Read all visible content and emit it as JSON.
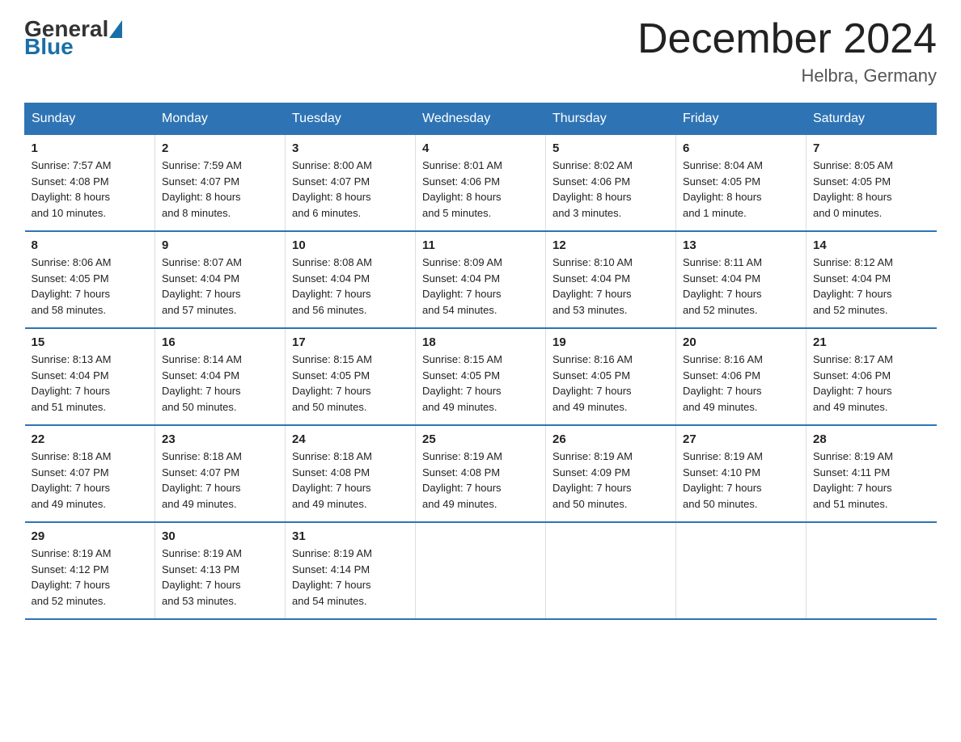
{
  "header": {
    "logo_general": "General",
    "logo_blue": "Blue",
    "main_title": "December 2024",
    "subtitle": "Helbra, Germany"
  },
  "days_of_week": [
    "Sunday",
    "Monday",
    "Tuesday",
    "Wednesday",
    "Thursday",
    "Friday",
    "Saturday"
  ],
  "weeks": [
    [
      {
        "day": "1",
        "sunrise": "7:57 AM",
        "sunset": "4:08 PM",
        "daylight": "8 hours and 10 minutes."
      },
      {
        "day": "2",
        "sunrise": "7:59 AM",
        "sunset": "4:07 PM",
        "daylight": "8 hours and 8 minutes."
      },
      {
        "day": "3",
        "sunrise": "8:00 AM",
        "sunset": "4:07 PM",
        "daylight": "8 hours and 6 minutes."
      },
      {
        "day": "4",
        "sunrise": "8:01 AM",
        "sunset": "4:06 PM",
        "daylight": "8 hours and 5 minutes."
      },
      {
        "day": "5",
        "sunrise": "8:02 AM",
        "sunset": "4:06 PM",
        "daylight": "8 hours and 3 minutes."
      },
      {
        "day": "6",
        "sunrise": "8:04 AM",
        "sunset": "4:05 PM",
        "daylight": "8 hours and 1 minute."
      },
      {
        "day": "7",
        "sunrise": "8:05 AM",
        "sunset": "4:05 PM",
        "daylight": "8 hours and 0 minutes."
      }
    ],
    [
      {
        "day": "8",
        "sunrise": "8:06 AM",
        "sunset": "4:05 PM",
        "daylight": "7 hours and 58 minutes."
      },
      {
        "day": "9",
        "sunrise": "8:07 AM",
        "sunset": "4:04 PM",
        "daylight": "7 hours and 57 minutes."
      },
      {
        "day": "10",
        "sunrise": "8:08 AM",
        "sunset": "4:04 PM",
        "daylight": "7 hours and 56 minutes."
      },
      {
        "day": "11",
        "sunrise": "8:09 AM",
        "sunset": "4:04 PM",
        "daylight": "7 hours and 54 minutes."
      },
      {
        "day": "12",
        "sunrise": "8:10 AM",
        "sunset": "4:04 PM",
        "daylight": "7 hours and 53 minutes."
      },
      {
        "day": "13",
        "sunrise": "8:11 AM",
        "sunset": "4:04 PM",
        "daylight": "7 hours and 52 minutes."
      },
      {
        "day": "14",
        "sunrise": "8:12 AM",
        "sunset": "4:04 PM",
        "daylight": "7 hours and 52 minutes."
      }
    ],
    [
      {
        "day": "15",
        "sunrise": "8:13 AM",
        "sunset": "4:04 PM",
        "daylight": "7 hours and 51 minutes."
      },
      {
        "day": "16",
        "sunrise": "8:14 AM",
        "sunset": "4:04 PM",
        "daylight": "7 hours and 50 minutes."
      },
      {
        "day": "17",
        "sunrise": "8:15 AM",
        "sunset": "4:05 PM",
        "daylight": "7 hours and 50 minutes."
      },
      {
        "day": "18",
        "sunrise": "8:15 AM",
        "sunset": "4:05 PM",
        "daylight": "7 hours and 49 minutes."
      },
      {
        "day": "19",
        "sunrise": "8:16 AM",
        "sunset": "4:05 PM",
        "daylight": "7 hours and 49 minutes."
      },
      {
        "day": "20",
        "sunrise": "8:16 AM",
        "sunset": "4:06 PM",
        "daylight": "7 hours and 49 minutes."
      },
      {
        "day": "21",
        "sunrise": "8:17 AM",
        "sunset": "4:06 PM",
        "daylight": "7 hours and 49 minutes."
      }
    ],
    [
      {
        "day": "22",
        "sunrise": "8:18 AM",
        "sunset": "4:07 PM",
        "daylight": "7 hours and 49 minutes."
      },
      {
        "day": "23",
        "sunrise": "8:18 AM",
        "sunset": "4:07 PM",
        "daylight": "7 hours and 49 minutes."
      },
      {
        "day": "24",
        "sunrise": "8:18 AM",
        "sunset": "4:08 PM",
        "daylight": "7 hours and 49 minutes."
      },
      {
        "day": "25",
        "sunrise": "8:19 AM",
        "sunset": "4:08 PM",
        "daylight": "7 hours and 49 minutes."
      },
      {
        "day": "26",
        "sunrise": "8:19 AM",
        "sunset": "4:09 PM",
        "daylight": "7 hours and 50 minutes."
      },
      {
        "day": "27",
        "sunrise": "8:19 AM",
        "sunset": "4:10 PM",
        "daylight": "7 hours and 50 minutes."
      },
      {
        "day": "28",
        "sunrise": "8:19 AM",
        "sunset": "4:11 PM",
        "daylight": "7 hours and 51 minutes."
      }
    ],
    [
      {
        "day": "29",
        "sunrise": "8:19 AM",
        "sunset": "4:12 PM",
        "daylight": "7 hours and 52 minutes."
      },
      {
        "day": "30",
        "sunrise": "8:19 AM",
        "sunset": "4:13 PM",
        "daylight": "7 hours and 53 minutes."
      },
      {
        "day": "31",
        "sunrise": "8:19 AM",
        "sunset": "4:14 PM",
        "daylight": "7 hours and 54 minutes."
      },
      null,
      null,
      null,
      null
    ]
  ],
  "labels": {
    "sunrise": "Sunrise:",
    "sunset": "Sunset:",
    "daylight": "Daylight:"
  }
}
